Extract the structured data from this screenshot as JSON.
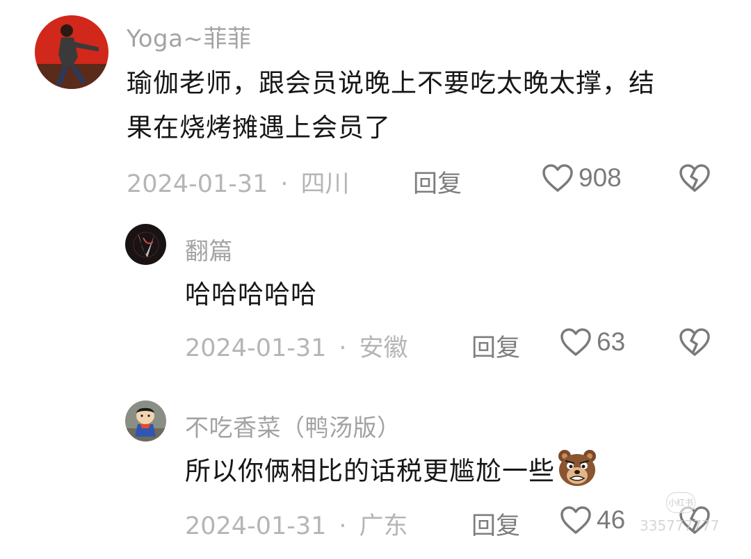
{
  "comments": [
    {
      "username": "Yoga~菲菲",
      "text": "瑜伽老师，跟会员说晚上不要吃太晚太撑，结果在烧烤摊遇上会员了",
      "date": "2024-01-31",
      "location": "四川",
      "reply_label": "回复",
      "likes": "908",
      "avatar": "red-background-person-avatar"
    },
    {
      "username": "翻篇",
      "text": "哈哈哈哈哈",
      "date": "2024-01-31",
      "location": "安徽",
      "reply_label": "回复",
      "likes": "63",
      "avatar": "dark-glowing-figure-avatar"
    },
    {
      "username": "不吃香菜（鸭汤版）",
      "text": "所以你俩相比的话税更尴尬一些",
      "date": "2024-01-31",
      "location": "广东",
      "reply_label": "回复",
      "likes": "46",
      "avatar": "cartoon-boy-avatar",
      "emoji": "bear-face-emoji"
    }
  ],
  "separator": "·",
  "icons": {
    "like": "heart-outline-icon",
    "dislike": "broken-heart-icon"
  },
  "watermark": {
    "logo": "小红书",
    "text": "335777777"
  },
  "colors": {
    "text_primary": "#161616",
    "text_secondary": "#a3a3a3",
    "icon": "#7a7a7a",
    "avatar_red": "#d2271b"
  }
}
